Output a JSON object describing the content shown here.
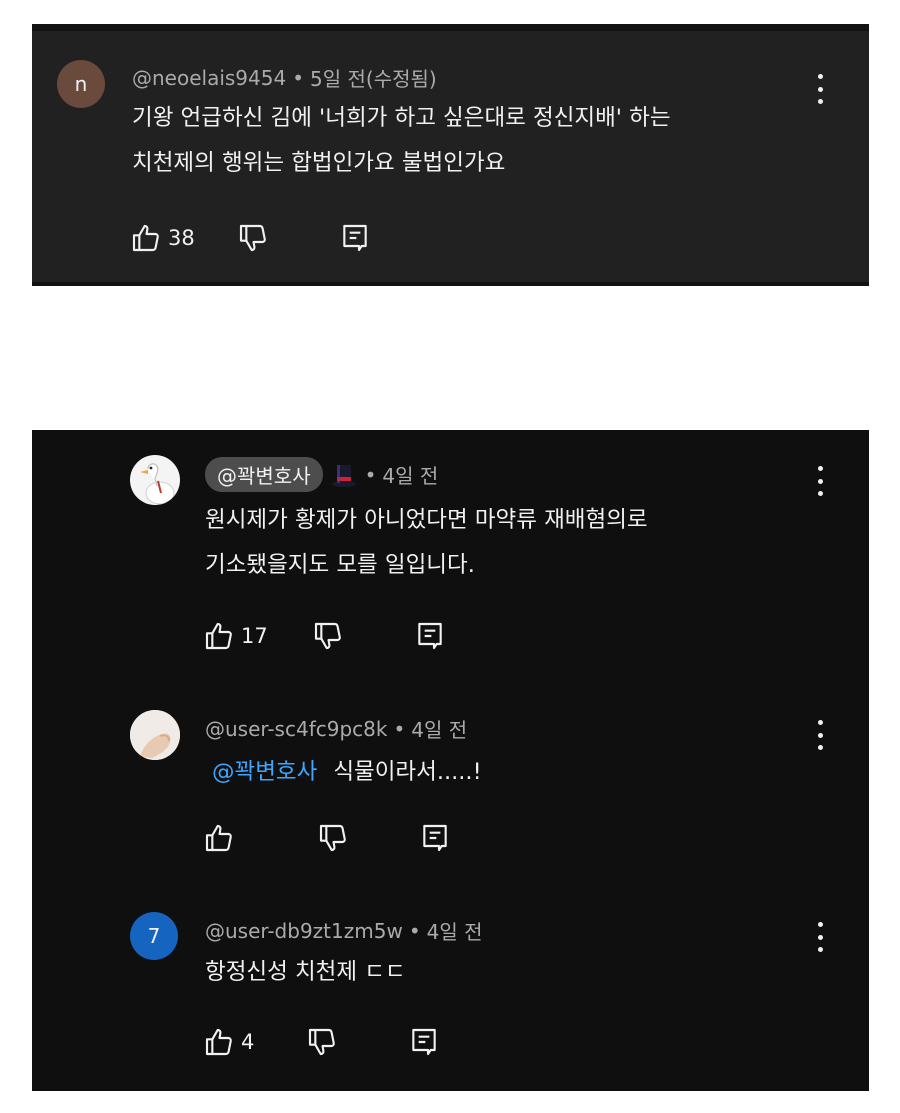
{
  "comments": [
    {
      "avatar_letter": "n",
      "avatar_color": "#6b4a3e",
      "handle": "@neoelais9454",
      "time": "5일 전(수정됨)",
      "lines": [
        "기왕 언급하신 김에 '너희가 하고 싶은대로 정신지배' 하는",
        "치천제의 행위는 합법인가요 불법인가요"
      ],
      "likes": "38"
    },
    {
      "avatar_icon": "goose-icon",
      "handle": "@꽉변호사",
      "badge_icon": "top-hat-icon",
      "time": "4일 전",
      "lines": [
        "원시제가 황제가 아니었다면 마약류 재배혐의로",
        "기소됐을지도 모를 일입니다."
      ],
      "likes": "17"
    },
    {
      "avatar_icon": "photo-avatar-icon",
      "handle": "@user-sc4fc9pc8k",
      "time": "4일 전",
      "mention": "@꽉변호사",
      "text": "식물이라서.....!",
      "likes": ""
    },
    {
      "avatar_letter": "7",
      "avatar_color": "#1565c0",
      "handle": "@user-db9zt1zm5w",
      "time": "4일 전",
      "lines": [
        "항정신성 치천제 ㄷㄷ"
      ],
      "likes": "4"
    }
  ],
  "icons": {
    "like": "thumbs-up-icon",
    "dislike": "thumbs-down-icon",
    "reply": "reply-icon",
    "menu": "more-vert-icon"
  },
  "separator": "•"
}
